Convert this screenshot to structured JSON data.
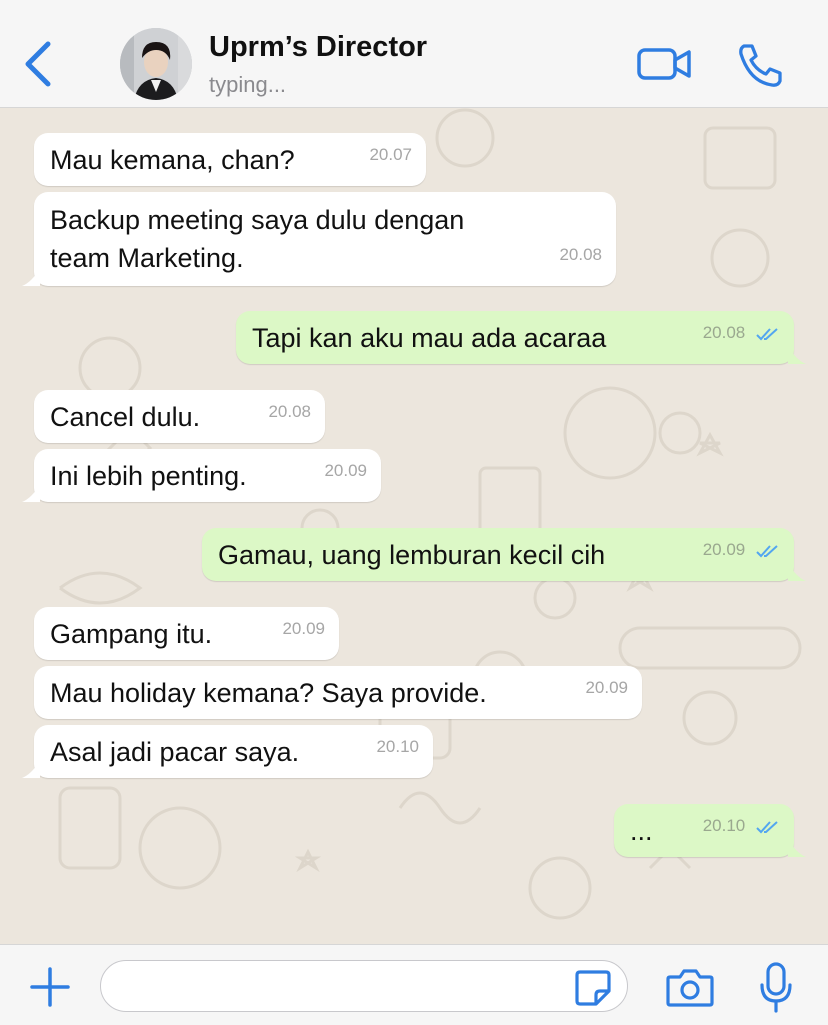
{
  "header": {
    "back_icon": "chevron-left-icon",
    "contact_name": "Uprm’s Director",
    "status": "typing...",
    "video_icon": "video-camera-icon",
    "call_icon": "phone-icon",
    "accent_color": "#2f7de1"
  },
  "messages": [
    {
      "dir": "in",
      "text": "Mau kemana, chan?",
      "time": "20.07"
    },
    {
      "dir": "in",
      "text": "Backup meeting saya dulu dengan team Marketing.",
      "time": "20.08"
    },
    {
      "dir": "out",
      "text": "Tapi kan aku mau ada acaraa",
      "time": "20.08",
      "status": "read"
    },
    {
      "dir": "in",
      "text": "Cancel dulu.",
      "time": "20.08"
    },
    {
      "dir": "in",
      "text": "Ini lebih penting.",
      "time": "20.09"
    },
    {
      "dir": "out",
      "text": "Gamau, uang lemburan kecil cih",
      "time": "20.09",
      "status": "read"
    },
    {
      "dir": "in",
      "text": "Gampang itu.",
      "time": "20.09"
    },
    {
      "dir": "in",
      "text": "Mau holiday kemana? Saya provide.",
      "time": "20.09"
    },
    {
      "dir": "in",
      "text": "Asal jadi pacar saya.",
      "time": "20.10"
    },
    {
      "dir": "out",
      "text": "...",
      "time": "20.10",
      "status": "read"
    }
  ],
  "composer": {
    "plus_icon": "plus-icon",
    "input_value": "",
    "sticker_icon": "sticker-icon",
    "camera_icon": "camera-icon",
    "mic_icon": "microphone-icon"
  },
  "colors": {
    "incoming_bubble": "#ffffff",
    "outgoing_bubble": "#dcf8c6",
    "read_ticks": "#53a6f0",
    "chat_background": "#ece6dd"
  }
}
